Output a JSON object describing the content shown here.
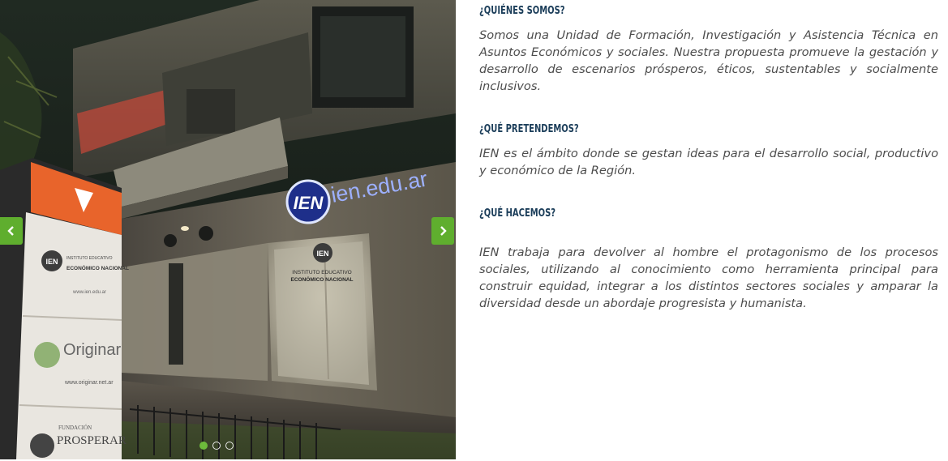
{
  "slider": {
    "sign_texts": {
      "ien_sign": "IEN",
      "domain_sign": "ien.edu.ar",
      "totem_inst_line1": "INSTITUTO EDUCATIVO",
      "totem_inst_line2": "ECONÓMICO NACIONAL",
      "totem_url": "www.ien.edu.ar",
      "totem_originar": "Originar",
      "totem_originar_url": "www.originar.net.ar",
      "totem_fundacion": "FUNDACIÓN",
      "totem_prosperar": "PROSPERAR",
      "window_line1": "INSTITUTO EDUCATIVO",
      "window_line2": "ECONÓMICO NACIONAL"
    },
    "prev_icon": "chevron-left-icon",
    "next_icon": "chevron-right-icon",
    "active_slide": 1,
    "slide_count": 3,
    "accent_color": "#5fae2e"
  },
  "sections": [
    {
      "heading": "¿QUIÉNES SOMOS?",
      "text": " Somos una Unidad de Formación, Investigación y Asistencia Técnica en Asuntos Económicos y sociales. Nuestra propuesta promueve la gestación y desarrollo de escenarios prósperos, éticos, sustentables y socialmente inclusivos."
    },
    {
      "heading": "¿QUÉ PRETENDEMOS?",
      "text": " IEN es el ámbito donde se gestan ideas para el desarrollo social, productivo y económico de la Región."
    },
    {
      "heading": "¿QUÉ HACEMOS?",
      "text": " IEN trabaja para devolver al hombre el protagonismo de los procesos sociales, utilizando al conocimiento como herramienta principal para construir equidad, integrar a los distintos sectores sociales y amparar la diversidad desde un abordaje progresista y humanista."
    }
  ],
  "colors": {
    "heading": "#1c3e5a",
    "body_text": "#4d4d4d"
  }
}
